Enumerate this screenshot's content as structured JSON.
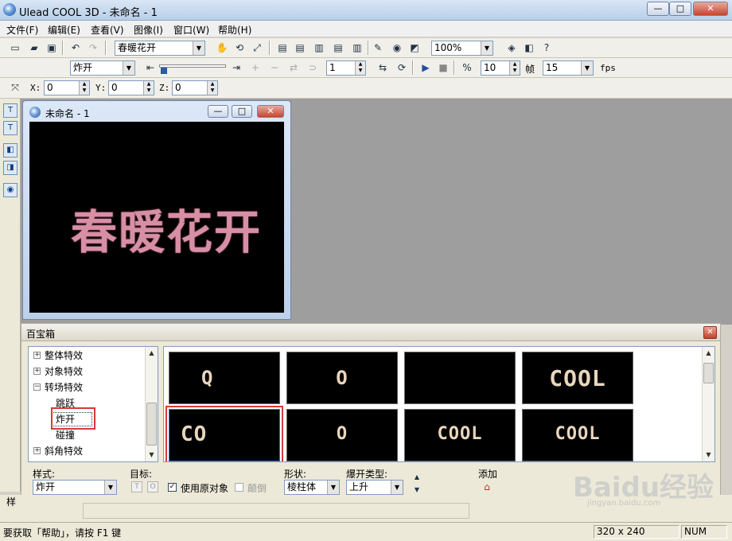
{
  "window": {
    "title": "Ulead COOL 3D - 未命名 - 1",
    "min": "—",
    "max": "□",
    "close": "✕"
  },
  "menu": [
    "文件(F)",
    "编辑(E)",
    "查看(V)",
    "图像(I)",
    "窗口(W)",
    "帮助(H)"
  ],
  "toolbar1": {
    "text_combo": "春暖花开",
    "zoom_combo": "100%"
  },
  "toolbar2": {
    "effect_combo": "炸开",
    "frame_value": "1",
    "fps_value": "10",
    "frame_label": "帧",
    "frames_total": "15",
    "fps_label": "fps"
  },
  "toolbar3": {
    "x_label": "X:",
    "x_value": "0",
    "y_label": "Y:",
    "y_value": "0",
    "z_label": "Z:",
    "z_value": "0"
  },
  "document": {
    "title": "未命名 - 1",
    "canvas_text": "春暖花开"
  },
  "panel": {
    "title": "百宝箱",
    "tree": [
      {
        "label": "整体特效",
        "expander": "+"
      },
      {
        "label": "对象特效",
        "expander": "+"
      },
      {
        "label": "转场特效",
        "expander": "−"
      },
      {
        "label": "跳跃",
        "expander": ""
      },
      {
        "label": "炸开",
        "expander": ""
      },
      {
        "label": "碰撞",
        "expander": ""
      },
      {
        "label": "斜角特效",
        "expander": "+"
      }
    ],
    "thumbnails": [
      "Q",
      "O",
      "",
      "COOL",
      "CO",
      "O",
      "COOL",
      "COOL"
    ],
    "options": {
      "style_label": "样式:",
      "style_value": "炸开",
      "target_label": "目标:",
      "target_btn1": "T",
      "target_btn2": "O",
      "use_original_label": "使用原对象",
      "reverse_label": "颠倒",
      "shape_label": "形状:",
      "shape_value": "棱柱体",
      "burst_label": "爆开类型:",
      "burst_value": "上升",
      "add_label": "添加"
    }
  },
  "tab_strip": {
    "label": "样"
  },
  "status": {
    "help": "要获取「帮助」，请按 F1 键",
    "size": "320 x 240",
    "num": "NUM"
  },
  "watermark": {
    "text": "Baidu经验",
    "sub": "jingyan.baidu.com"
  },
  "colors": {
    "canvas_text": "#d78fa6",
    "highlight": "#d63a3a"
  }
}
